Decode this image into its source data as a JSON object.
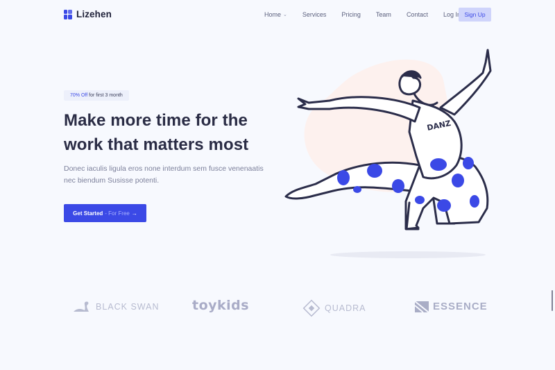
{
  "brand": {
    "name": "Lizehen"
  },
  "nav": {
    "items": [
      {
        "label": "Home",
        "has_dropdown": true
      },
      {
        "label": "Services"
      },
      {
        "label": "Pricing"
      },
      {
        "label": "Team"
      },
      {
        "label": "Contact"
      },
      {
        "label": "Log In"
      }
    ],
    "signup_label": "Sign Up"
  },
  "hero": {
    "badge_highlight": "70% Off",
    "badge_text": "for first 3 month",
    "headline": "Make more time for the work that matters most",
    "subtitle": "Donec iaculis ligula eros none interdum sem fusce venenaatis nec biendum Susisse potenti.",
    "cta_label": "Get Started",
    "cta_suffix": "- For Free",
    "illustration_text": "DANZ"
  },
  "logos": [
    {
      "name": "BLACK SWAN",
      "icon": "swan-icon"
    },
    {
      "name": "toykids",
      "icon": ""
    },
    {
      "name": "QUADRA",
      "icon": "diamond-icon"
    },
    {
      "name": "ESSENCE",
      "icon": "essence-icon"
    }
  ],
  "colors": {
    "accent": "#3b49e6",
    "background": "#f7f9fe",
    "heading": "#2a2c45",
    "muted": "#7c809b",
    "logo_gray": "#b7bbd0"
  }
}
